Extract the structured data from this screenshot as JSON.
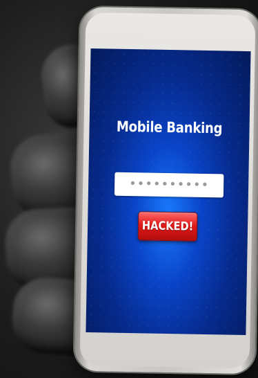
{
  "screen": {
    "title": "Mobile Banking",
    "password_value": "••••••••••",
    "button_label": "HACKED!"
  },
  "colors": {
    "screen_accent": "#0a44c8",
    "button_red": "#e01a1a"
  }
}
